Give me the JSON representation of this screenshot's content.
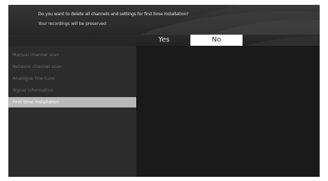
{
  "dialog": {
    "question": "Do you want to delete all channels and settings for first time installation?",
    "subtext": "Your recordings will be preserved",
    "yes_label": "Yes",
    "no_label": "No",
    "focused": "No"
  },
  "menu": {
    "items": [
      {
        "label": "Manual channel scan",
        "selected": false
      },
      {
        "label": "Network channel scan",
        "selected": false
      },
      {
        "label": "Analogue fine tune",
        "selected": false
      },
      {
        "label": "Signal Information",
        "selected": false
      },
      {
        "label": "First time installation",
        "selected": true
      }
    ]
  },
  "colors": {
    "background": "#1b1b1b",
    "sidebar": "#2c2c2c",
    "selected_item": "#b9b9b9",
    "focused_button": "#ffffff"
  }
}
